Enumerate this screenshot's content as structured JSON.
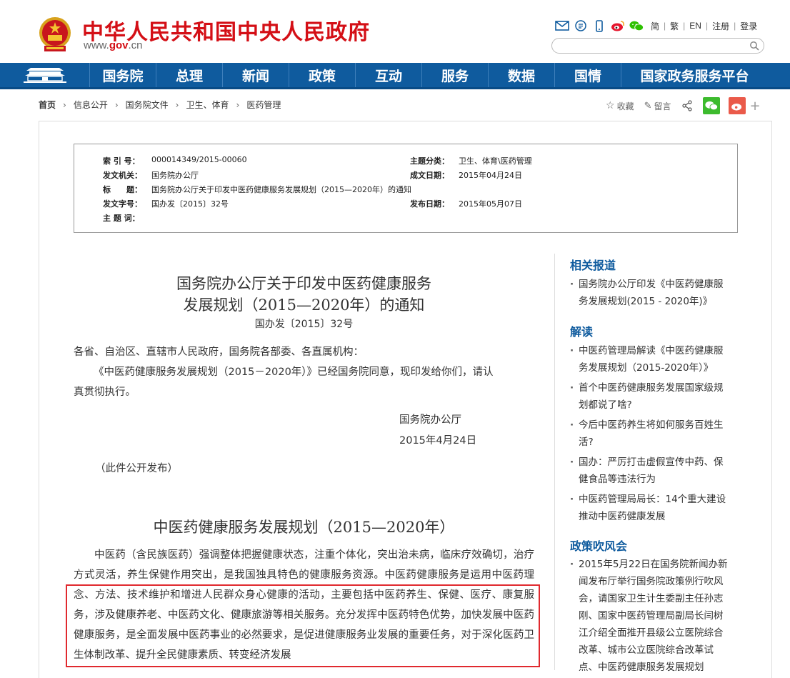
{
  "header": {
    "site_title": "中华人民共和国中央人民政府",
    "site_url_prefix": "www.",
    "site_url_domain": "gov",
    "site_url_suffix": ".cn",
    "icons": [
      "mail-icon",
      "rss-icon",
      "mobile-icon",
      "weibo-icon",
      "wechat-icon"
    ],
    "links": [
      "简",
      "繁",
      "EN",
      "注册",
      "登录"
    ],
    "search_placeholder": ""
  },
  "nav": {
    "items": [
      "国务院",
      "总理",
      "新闻",
      "政策",
      "互动",
      "服务",
      "数据",
      "国情",
      "国家政务服务平台"
    ]
  },
  "breadcrumb": [
    "首页",
    "信息公开",
    "国务院文件",
    "卫生、体育",
    "医药管理"
  ],
  "share": {
    "favorite": "收藏",
    "comment": "留言"
  },
  "meta": {
    "index_key": "索 引 号：",
    "index_val": "000014349/2015-00060",
    "topic_key": "主题分类：",
    "topic_val": "卫生、体育\\医药管理",
    "issuer_key": "发文机关：",
    "issuer_val": "国务院办公厅",
    "written_key": "成文日期：",
    "written_val": "2015年04月24日",
    "title_key": "标　　题：",
    "title_val": "国务院办公厅关于印发中医药健康服务发展规划（2015—2020年）的通知",
    "docno_key": "发文字号：",
    "docno_val": "国办发〔2015〕32号",
    "pub_key": "发布日期：",
    "pub_val": "2015年05月07日",
    "kw_key": "主 题 词：",
    "kw_val": ""
  },
  "article": {
    "title_line1": "国务院办公厅关于印发中医药健康服务",
    "title_line2": "发展规划（2015—2020年）的通知",
    "doc_number": "国办发〔2015〕32号",
    "salutation": "各省、自治区、直辖市人民政府，国务院各部委、各直属机构：",
    "notice_line1": "《中医药健康服务发展规划（2015－2020年）》已经国务院同意，现印发给你们，请认",
    "notice_line2": "真贯彻执行。",
    "signer": "国务院办公厅",
    "sign_date": "2015年4月24日",
    "public_note": "（此件公开发布）",
    "plan_title": "中医药健康服务发展规划（2015—2020年）",
    "body": "中医药（含民族医药）强调整体把握健康状态，注重个体化，突出治未病，临床疗效确切，治疗方式灵活，养生保健作用突出，是我国独具特色的健康服务资源。中医药健康服务是运用中医药理念、方法、技术维护和增进人民群众身心健康的活动，主要包括中医药养生、保健、医疗、康复服务，涉及健康养老、中医药文化、健康旅游等相关服务。充分发挥中医药特色优势，加快发展中医药健康服务，是全面发展中医药事业的必然要求，是促进健康服务业发展的重要任务，对于深化医药卫生体制改革、提升全民健康素质、转变经济发展"
  },
  "sidebar": {
    "related_title": "相关报道",
    "related": [
      "国务院办公厅印发《中医药健康服",
      "务发展规划(2015 - 2020年)》"
    ],
    "interp_title": "解读",
    "interp": [
      [
        "中医药管理局解读《中医药健康服",
        "务发展规划（2015-2020年）》"
      ],
      [
        "首个中医药健康服务发展国家级规",
        "划都说了啥?"
      ],
      [
        "今后中医药养生将如何服务百姓生",
        "活?"
      ],
      [
        "国办：严厉打击虚假宣传中药、保",
        "健食品等违法行为"
      ],
      [
        "中医药管理局局长：14个重大建设",
        "推动中医药健康发展"
      ]
    ],
    "policy_title": "政策吹风会",
    "policy": [
      "2015年5月22日在国务院新闻办新",
      "闻发布厅举行国务院政策例行吹风",
      "会，请国家卫生计生委副主任孙志",
      "刚、国家中医药管理局副局长闫树",
      "江介绍全面推开县级公立医院综合",
      "改革、城市公立医院综合改革试",
      "点、中医药健康服务发展规划"
    ]
  },
  "colors": {
    "brand_red": "#d40f16",
    "nav_blue": "#0f5b9e",
    "highlight": "#e0292e"
  }
}
